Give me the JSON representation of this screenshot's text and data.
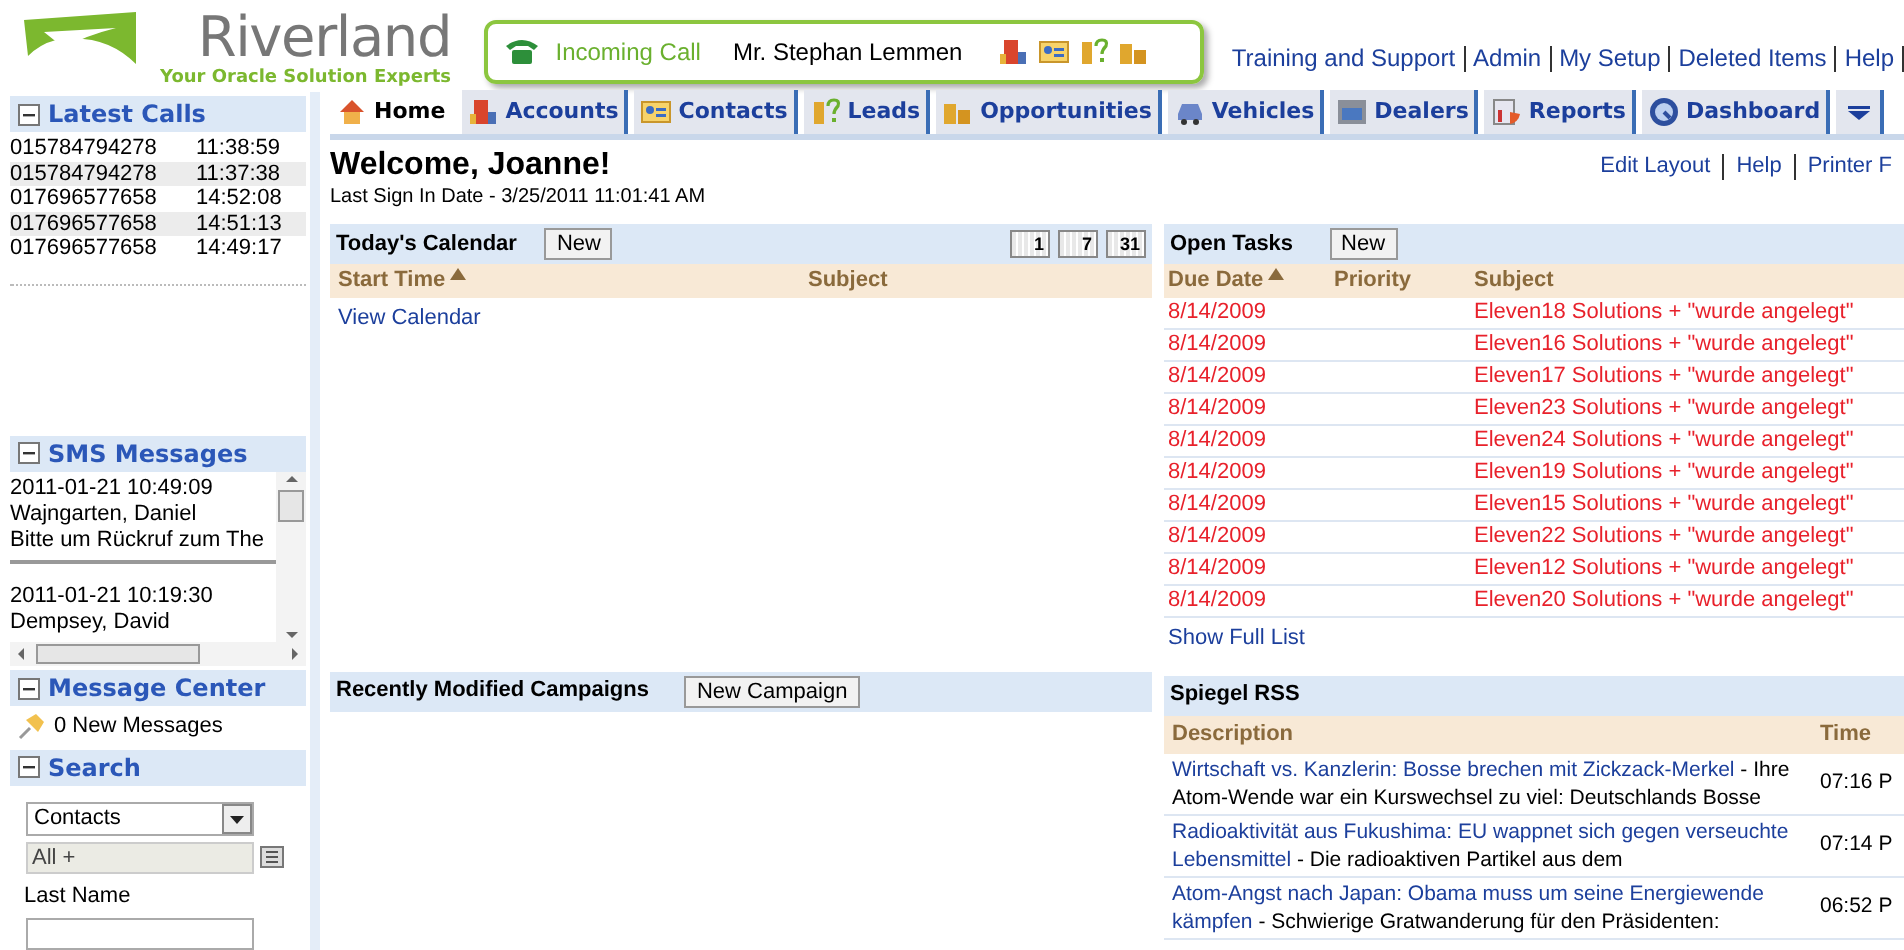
{
  "logo": {
    "name": "Riverland",
    "tagline": "Your Oracle Solution Experts"
  },
  "call_bar": {
    "status": "Incoming Call",
    "caller": "Mr. Stephan Lemmen"
  },
  "top_links": [
    "Training and Support",
    "Admin",
    "My Setup",
    "Deleted Items",
    "Help"
  ],
  "sidebar": {
    "latest_calls": {
      "title": "Latest Calls",
      "rows": [
        {
          "number": "015784794278",
          "time": "11:38:59"
        },
        {
          "number": "015784794278",
          "time": "11:37:38"
        },
        {
          "number": "017696577658",
          "time": "14:52:08"
        },
        {
          "number": "017696577658",
          "time": "14:51:13"
        },
        {
          "number": "017696577658",
          "time": "14:49:17"
        }
      ]
    },
    "sms": {
      "title": "SMS Messages",
      "messages": [
        {
          "date": "2011-01-21 10:49:09",
          "sender": "Wajngarten, Daniel",
          "text": "Bitte um Rückruf zum The"
        },
        {
          "date": "2011-01-21 10:19:30",
          "sender": "Dempsey, David"
        }
      ]
    },
    "message_center": {
      "title": "Message Center",
      "text": "0 New Messages"
    },
    "search": {
      "title": "Search",
      "object": "Contacts",
      "filter": "All +",
      "field_label": "Last Name"
    }
  },
  "tabs": [
    {
      "label": "Home",
      "selected": true
    },
    {
      "label": "Accounts",
      "selected": false
    },
    {
      "label": "Contacts",
      "selected": false
    },
    {
      "label": "Leads",
      "selected": false
    },
    {
      "label": "Opportunities",
      "selected": false
    },
    {
      "label": "Vehicles",
      "selected": false
    },
    {
      "label": "Dealers",
      "selected": false
    },
    {
      "label": "Reports",
      "selected": false
    },
    {
      "label": "Dashboard",
      "selected": false
    }
  ],
  "welcome": "Welcome, Joanne!",
  "last_sign_in": "Last Sign In Date - 3/25/2011 11:01:41 AM",
  "page_links": [
    "Edit Layout",
    "Help",
    "Printer F"
  ],
  "calendar": {
    "title": "Today's Calendar",
    "new_button": "New",
    "view_buttons": [
      "1",
      "7",
      "31"
    ],
    "columns": [
      {
        "label": "Start Time",
        "sorted": true
      },
      {
        "label": "Subject",
        "sorted": false
      }
    ],
    "link": "View Calendar"
  },
  "tasks": {
    "title": "Open Tasks",
    "new_button": "New",
    "columns": [
      {
        "label": "Due Date",
        "sorted": true
      },
      {
        "label": "Priority",
        "sorted": false
      },
      {
        "label": "Subject",
        "sorted": false
      }
    ],
    "rows": [
      {
        "due": "8/14/2009",
        "subject": "Eleven18 Solutions + \"wurde angelegt\""
      },
      {
        "due": "8/14/2009",
        "subject": "Eleven16 Solutions + \"wurde angelegt\""
      },
      {
        "due": "8/14/2009",
        "subject": "Eleven17 Solutions + \"wurde angelegt\""
      },
      {
        "due": "8/14/2009",
        "subject": "Eleven23 Solutions + \"wurde angelegt\""
      },
      {
        "due": "8/14/2009",
        "subject": "Eleven24 Solutions + \"wurde angelegt\""
      },
      {
        "due": "8/14/2009",
        "subject": "Eleven19 Solutions + \"wurde angelegt\""
      },
      {
        "due": "8/14/2009",
        "subject": "Eleven15 Solutions + \"wurde angelegt\""
      },
      {
        "due": "8/14/2009",
        "subject": "Eleven22 Solutions + \"wurde angelegt\""
      },
      {
        "due": "8/14/2009",
        "subject": "Eleven12 Solutions + \"wurde angelegt\""
      },
      {
        "due": "8/14/2009",
        "subject": "Eleven20 Solutions + \"wurde angelegt\""
      }
    ],
    "link": "Show Full List"
  },
  "campaigns": {
    "title": "Recently Modified Campaigns",
    "button": "New Campaign"
  },
  "rss": {
    "title": "Spiegel RSS",
    "columns": [
      "Description",
      "Time"
    ],
    "rows": [
      {
        "title_lines": [
          "Wirtschaft vs. Kanzlerin: Bosse brechen mit Zickzack-Merkel"
        ],
        "summary": "- Ihre Atom-Wende war ein Kurswechsel zu viel: Deutschlands Bosse",
        "time": "07:16 P"
      },
      {
        "title_lines": [
          "Radioaktivität aus Fukushima: EU wappnet sich gegen verseuchte",
          "Lebensmittel"
        ],
        "summary": "- Die radioaktiven Partikel aus dem",
        "time": "07:14 P"
      },
      {
        "title_lines": [
          "Atom-Angst nach Japan: Obama muss um seine Energiewende",
          "kämpfen"
        ],
        "summary": "- Schwierige Gratwanderung für den Präsidenten:",
        "time": "06:52 P"
      }
    ]
  }
}
